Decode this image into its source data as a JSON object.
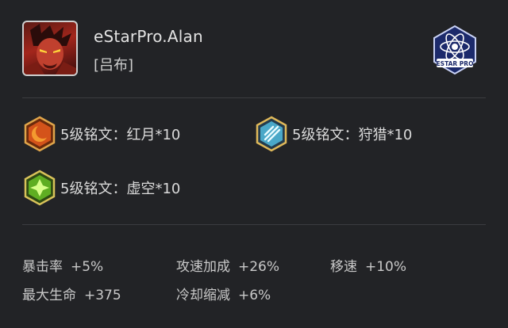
{
  "player": {
    "name": "eStarPro.Alan",
    "hero": "[吕布]"
  },
  "team_logo": {
    "text": "ESTAR PRO",
    "icon": "estar-pro-logo"
  },
  "runes": [
    {
      "label": "5级铭文：红月*10",
      "icon": "red-moon-rune-icon",
      "color": "#e2661f"
    },
    {
      "label": "5级铭文：狩猎*10",
      "icon": "hunt-rune-icon",
      "color": "#3aa6c9"
    },
    {
      "label": "5级铭文：虚空*10",
      "icon": "void-rune-icon",
      "color": "#6fbf2a"
    }
  ],
  "stats": [
    {
      "name": "暴击率",
      "value": "+5%"
    },
    {
      "name": "攻速加成",
      "value": "+26%"
    },
    {
      "name": "移速",
      "value": "+10%"
    },
    {
      "name": "最大生命",
      "value": "+375"
    },
    {
      "name": "冷却缩减",
      "value": "+6%"
    }
  ]
}
